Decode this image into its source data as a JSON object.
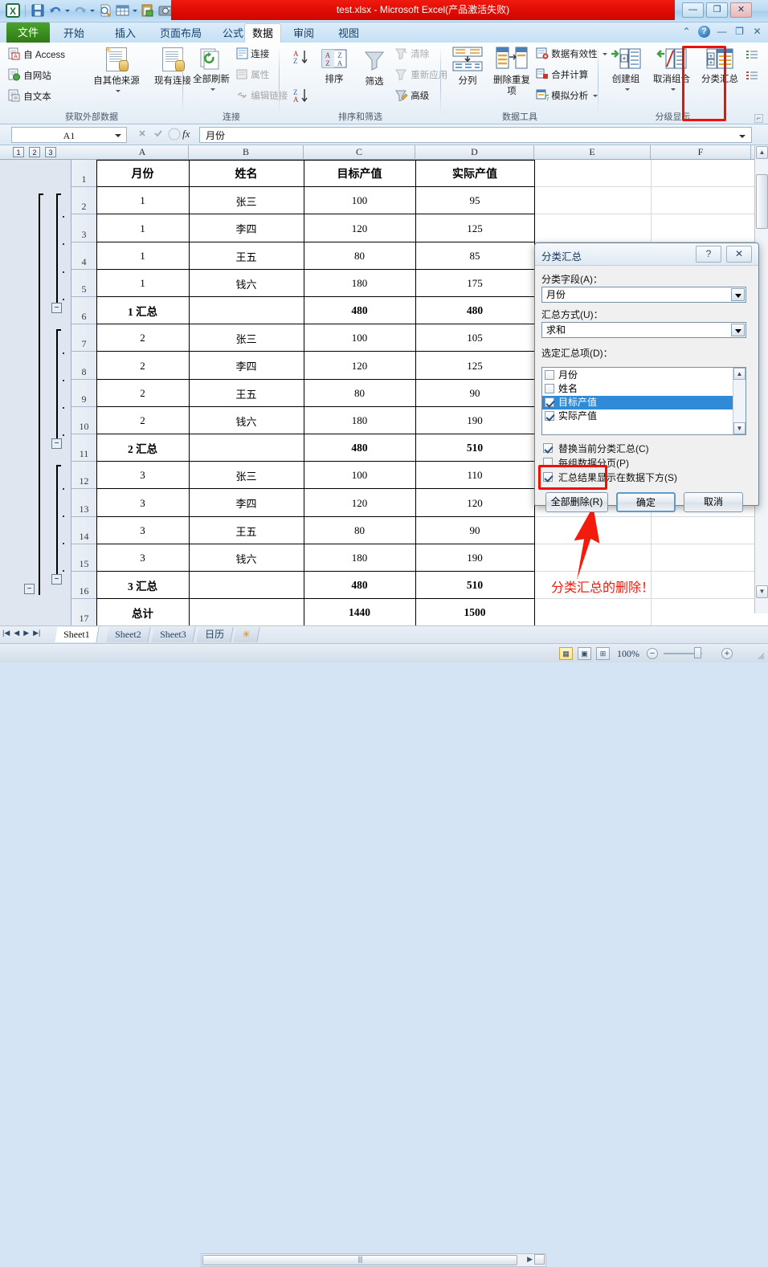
{
  "window": {
    "title": "test.xlsx  -  Microsoft Excel(产品激活失败)",
    "minimize": "—",
    "restore": "❐",
    "close": "✕"
  },
  "quick_access": {
    "items": [
      {
        "name": "excel-logo-icon",
        "label": "X"
      },
      {
        "name": "save-icon",
        "label": "Save"
      },
      {
        "name": "undo-icon",
        "label": "Undo"
      },
      {
        "name": "redo-icon",
        "label": "Redo"
      },
      {
        "name": "print-preview-icon",
        "label": "Print Preview"
      },
      {
        "name": "table-icon",
        "label": "Table"
      },
      {
        "name": "paste-icon",
        "label": "Paste"
      },
      {
        "name": "screenshot-icon",
        "label": "Screenshot"
      },
      {
        "name": "customize-qat-icon",
        "label": "Customize"
      }
    ]
  },
  "ribbon": {
    "file_tab": "文件",
    "tabs": [
      {
        "label": "开始",
        "active": false
      },
      {
        "label": "插入",
        "active": false
      },
      {
        "label": "页面布局",
        "active": false
      },
      {
        "label": "公式",
        "active": false
      },
      {
        "label": "数据",
        "active": true
      },
      {
        "label": "审阅",
        "active": false
      },
      {
        "label": "视图",
        "active": false
      }
    ],
    "right_icons": [
      {
        "name": "collapse-ribbon-icon",
        "glyph": "⌃"
      },
      {
        "name": "help-icon",
        "glyph": "?"
      },
      {
        "name": "minimize-window-icon",
        "glyph": "—"
      },
      {
        "name": "restore-window-icon",
        "glyph": "❐"
      },
      {
        "name": "close-window-icon",
        "glyph": "✕"
      }
    ],
    "groups": [
      {
        "name": "获取外部数据",
        "label": "获取外部数据",
        "small_buttons": [
          "自 Access",
          "自网站",
          "自文本"
        ],
        "big_buttons": [
          "自其他来源",
          "现有连接"
        ]
      },
      {
        "name": "连接",
        "label": "连接",
        "big_buttons": [
          "全部刷新"
        ],
        "small_buttons": [
          "连接",
          "属性",
          "编辑链接"
        ]
      },
      {
        "name": "排序和筛选",
        "label": "排序和筛选",
        "big_buttons": [
          "排序",
          "筛选"
        ],
        "small_buttons": [
          "清除",
          "重新应用",
          "高级"
        ],
        "sort_asc": "A↓Z",
        "sort_desc": "Z↓A"
      },
      {
        "name": "数据工具",
        "label": "数据工具",
        "big_buttons": [
          "分列",
          "删除重复项"
        ],
        "small_buttons": [
          "数据有效性",
          "合并计算",
          "模拟分析"
        ]
      },
      {
        "name": "分级显示",
        "label": "分级显示",
        "big_buttons": [
          "创建组",
          "取消组合",
          "分类汇总"
        ],
        "small_buttons": [
          "显示明细数据",
          "隐藏明细数据"
        ],
        "highlighted_button": "分类汇总"
      }
    ]
  },
  "formula_bar": {
    "name_box": "A1",
    "cancel_icon": "✕",
    "enter_icon": "✓",
    "fx_label": "fx",
    "content": "月份"
  },
  "grid": {
    "outline_levels": [
      "1",
      "2",
      "3"
    ],
    "columns": [
      "A",
      "B",
      "C",
      "D",
      "E",
      "F"
    ],
    "column_headers": [
      "月份",
      "姓名",
      "目标产值",
      "实际产值"
    ],
    "rows": [
      {
        "num": "1",
        "type": "header",
        "a": "月份",
        "b": "姓名",
        "c": "目标产值",
        "d": "实际产值"
      },
      {
        "num": "2",
        "type": "data",
        "a": "1",
        "b": "张三",
        "c": "100",
        "d": "95"
      },
      {
        "num": "3",
        "type": "data",
        "a": "1",
        "b": "李四",
        "c": "120",
        "d": "125"
      },
      {
        "num": "4",
        "type": "data",
        "a": "1",
        "b": "王五",
        "c": "80",
        "d": "85"
      },
      {
        "num": "5",
        "type": "data",
        "a": "1",
        "b": "钱六",
        "c": "180",
        "d": "175"
      },
      {
        "num": "6",
        "type": "subtotal",
        "a": "1 汇总",
        "b": "",
        "c": "480",
        "d": "480"
      },
      {
        "num": "7",
        "type": "data",
        "a": "2",
        "b": "张三",
        "c": "100",
        "d": "105"
      },
      {
        "num": "8",
        "type": "data",
        "a": "2",
        "b": "李四",
        "c": "120",
        "d": "125"
      },
      {
        "num": "9",
        "type": "data",
        "a": "2",
        "b": "王五",
        "c": "80",
        "d": "90"
      },
      {
        "num": "10",
        "type": "data",
        "a": "2",
        "b": "钱六",
        "c": "180",
        "d": "190"
      },
      {
        "num": "11",
        "type": "subtotal",
        "a": "2 汇总",
        "b": "",
        "c": "480",
        "d": "510"
      },
      {
        "num": "12",
        "type": "data",
        "a": "3",
        "b": "张三",
        "c": "100",
        "d": "110"
      },
      {
        "num": "13",
        "type": "data",
        "a": "3",
        "b": "李四",
        "c": "120",
        "d": "120"
      },
      {
        "num": "14",
        "type": "data",
        "a": "3",
        "b": "王五",
        "c": "80",
        "d": "90"
      },
      {
        "num": "15",
        "type": "data",
        "a": "3",
        "b": "钱六",
        "c": "180",
        "d": "190"
      },
      {
        "num": "16",
        "type": "subtotal",
        "a": "3 汇总",
        "b": "",
        "c": "480",
        "d": "510"
      },
      {
        "num": "17",
        "type": "grand",
        "a": "总计",
        "b": "",
        "c": "1440",
        "d": "1500"
      }
    ]
  },
  "dialog": {
    "title": "分类汇总",
    "help_btn": "?",
    "close_btn": "✕",
    "field_label": "分类字段(A)：",
    "field_value": "月份",
    "func_label": "汇总方式(U)：",
    "func_value": "求和",
    "items_label": "选定汇总项(D)：",
    "items": [
      {
        "label": "月份",
        "checked": false,
        "selected": false
      },
      {
        "label": "姓名",
        "checked": false,
        "selected": false
      },
      {
        "label": "目标产值",
        "checked": true,
        "selected": true
      },
      {
        "label": "实际产值",
        "checked": true,
        "selected": false
      }
    ],
    "options": [
      {
        "label": "替换当前分类汇总(C)",
        "checked": true
      },
      {
        "label": "每组数据分页(P)",
        "checked": false
      },
      {
        "label": "汇总结果显示在数据下方(S)",
        "checked": true
      }
    ],
    "buttons": [
      {
        "name": "remove-all-button",
        "label": "全部删除(R)",
        "highlighted": true
      },
      {
        "name": "ok-button",
        "label": "确定",
        "default": true
      },
      {
        "name": "cancel-button",
        "label": "取消"
      }
    ]
  },
  "annotation": {
    "text": "分类汇总的删除！",
    "color": "#f31b0c"
  },
  "sheet_tabs": {
    "nav": [
      "|◀",
      "◀",
      "▶",
      "▶|"
    ],
    "tabs": [
      {
        "label": "Sheet1",
        "active": true
      },
      {
        "label": "Sheet2",
        "active": false
      },
      {
        "label": "Sheet3",
        "active": false
      },
      {
        "label": "日历",
        "active": false
      }
    ],
    "insert_sheet_icon": "✳"
  },
  "status_bar": {
    "view_buttons": [
      {
        "name": "normal-view-button",
        "glyph": "▦",
        "selected": true
      },
      {
        "name": "page-layout-view-button",
        "glyph": "▣",
        "selected": false
      },
      {
        "name": "page-break-view-button",
        "glyph": "⊞",
        "selected": false
      }
    ],
    "zoom_label": "100%",
    "zoom_out": "−",
    "zoom_in": "+"
  },
  "colors": {
    "title_red": "#e00d04",
    "file_green": "#2f7a16",
    "highlight_red": "#f01000",
    "selection_blue": "#2f8bd8"
  }
}
